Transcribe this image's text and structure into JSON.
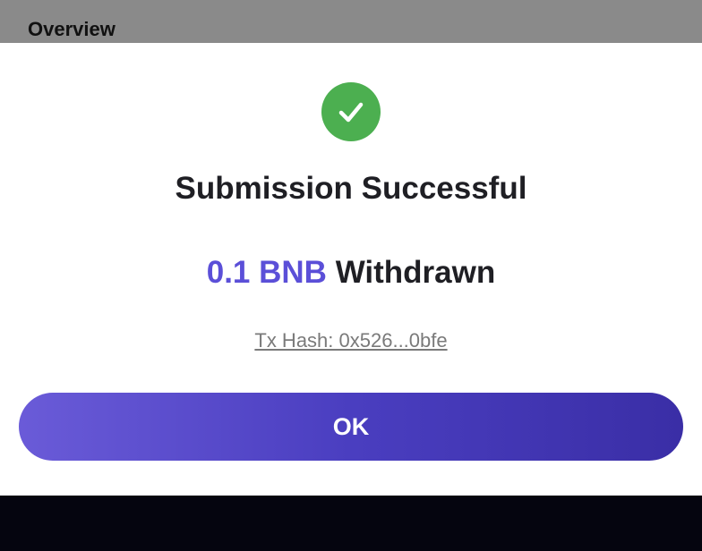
{
  "background": {
    "title": "Overview"
  },
  "dialog": {
    "status_icon": "check-circle-icon",
    "title": "Submission Successful",
    "amount": "0.1 BNB",
    "action": "Withdrawn",
    "tx_hash_label": "Tx Hash: 0x526...0bfe",
    "ok_label": "OK"
  },
  "colors": {
    "success": "#4caf50",
    "accent": "#5b4fd8",
    "button_gradient_start": "#6a5bd8",
    "button_gradient_end": "#3a2ea6"
  }
}
